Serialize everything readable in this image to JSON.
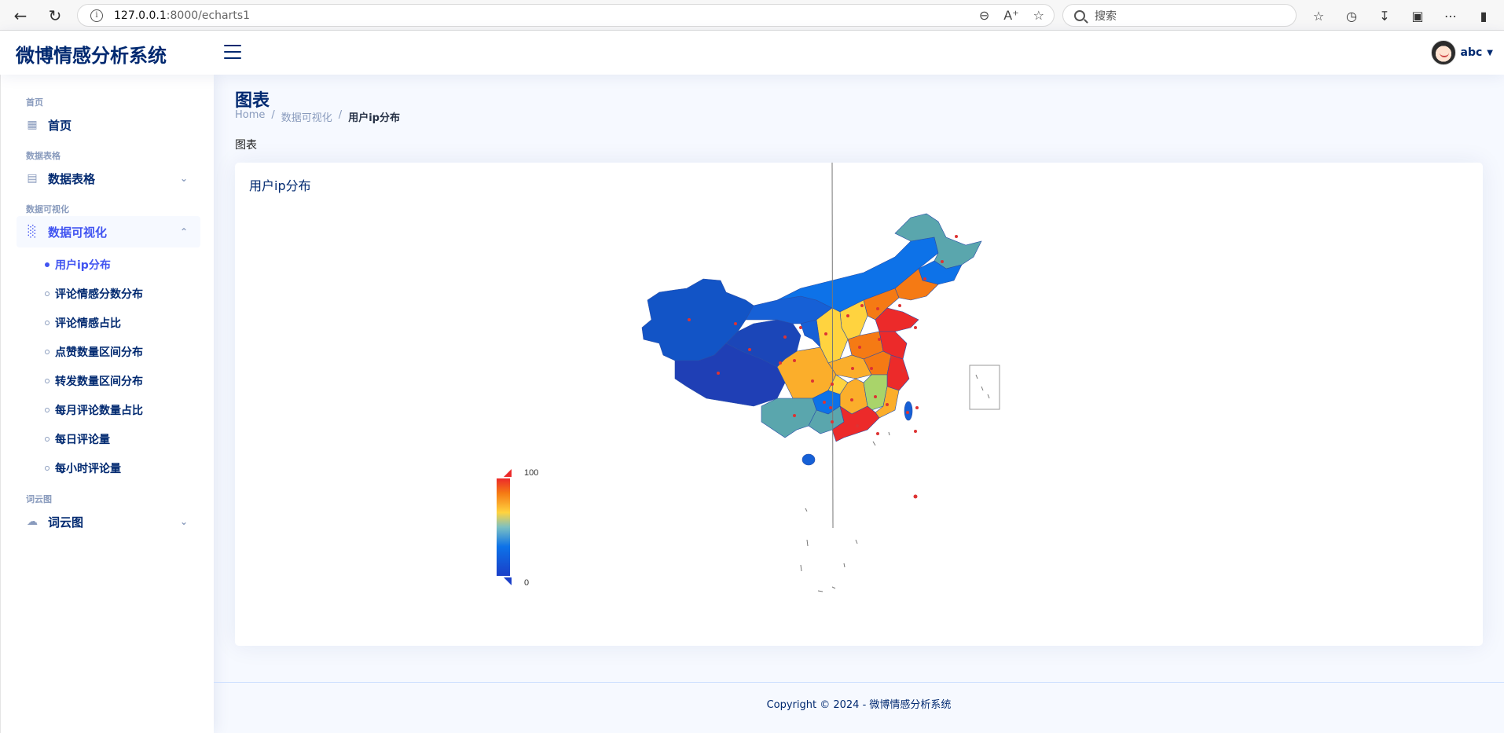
{
  "browser": {
    "url_host": "127.0.0.1",
    "url_path": ":8000/echarts1",
    "search_placeholder": "搜索"
  },
  "header": {
    "logo": "微博情感分析系统",
    "user_name": "abc"
  },
  "sidebar": {
    "sections": [
      {
        "heading": "首页",
        "item": "首页",
        "icon": "grid-icon"
      },
      {
        "heading": "数据表格",
        "item": "数据表格",
        "icon": "table-icon"
      },
      {
        "heading": "数据可视化",
        "item": "数据可视化",
        "icon": "bar-chart-icon"
      },
      {
        "heading": "词云图",
        "item": "词云图",
        "icon": "cloud-icon"
      }
    ],
    "sub_items": [
      "用户ip分布",
      "评论情感分数分布",
      "评论情感占比",
      "点赞数量区间分布",
      "转发数量区间分布",
      "每月评论数量占比",
      "每日评论量",
      "每小时评论量"
    ]
  },
  "main": {
    "title": "图表",
    "breadcrumb": [
      "Home",
      "数据可视化",
      "用户ip分布"
    ],
    "subtitle": "图表",
    "card_title": "用户ip分布"
  },
  "chart_data": {
    "type": "map",
    "visual_map": {
      "min": 0,
      "max": 100,
      "min_label": "0",
      "max_label": "100"
    },
    "colors": [
      "#1f3fb5",
      "#0d72e8",
      "#5aa6ad",
      "#ffd33f",
      "#fbae2b",
      "#f57a14",
      "#ec2a2a"
    ]
  },
  "footer": {
    "text": "Copyright © 2024 - 微博情感分析系统"
  }
}
